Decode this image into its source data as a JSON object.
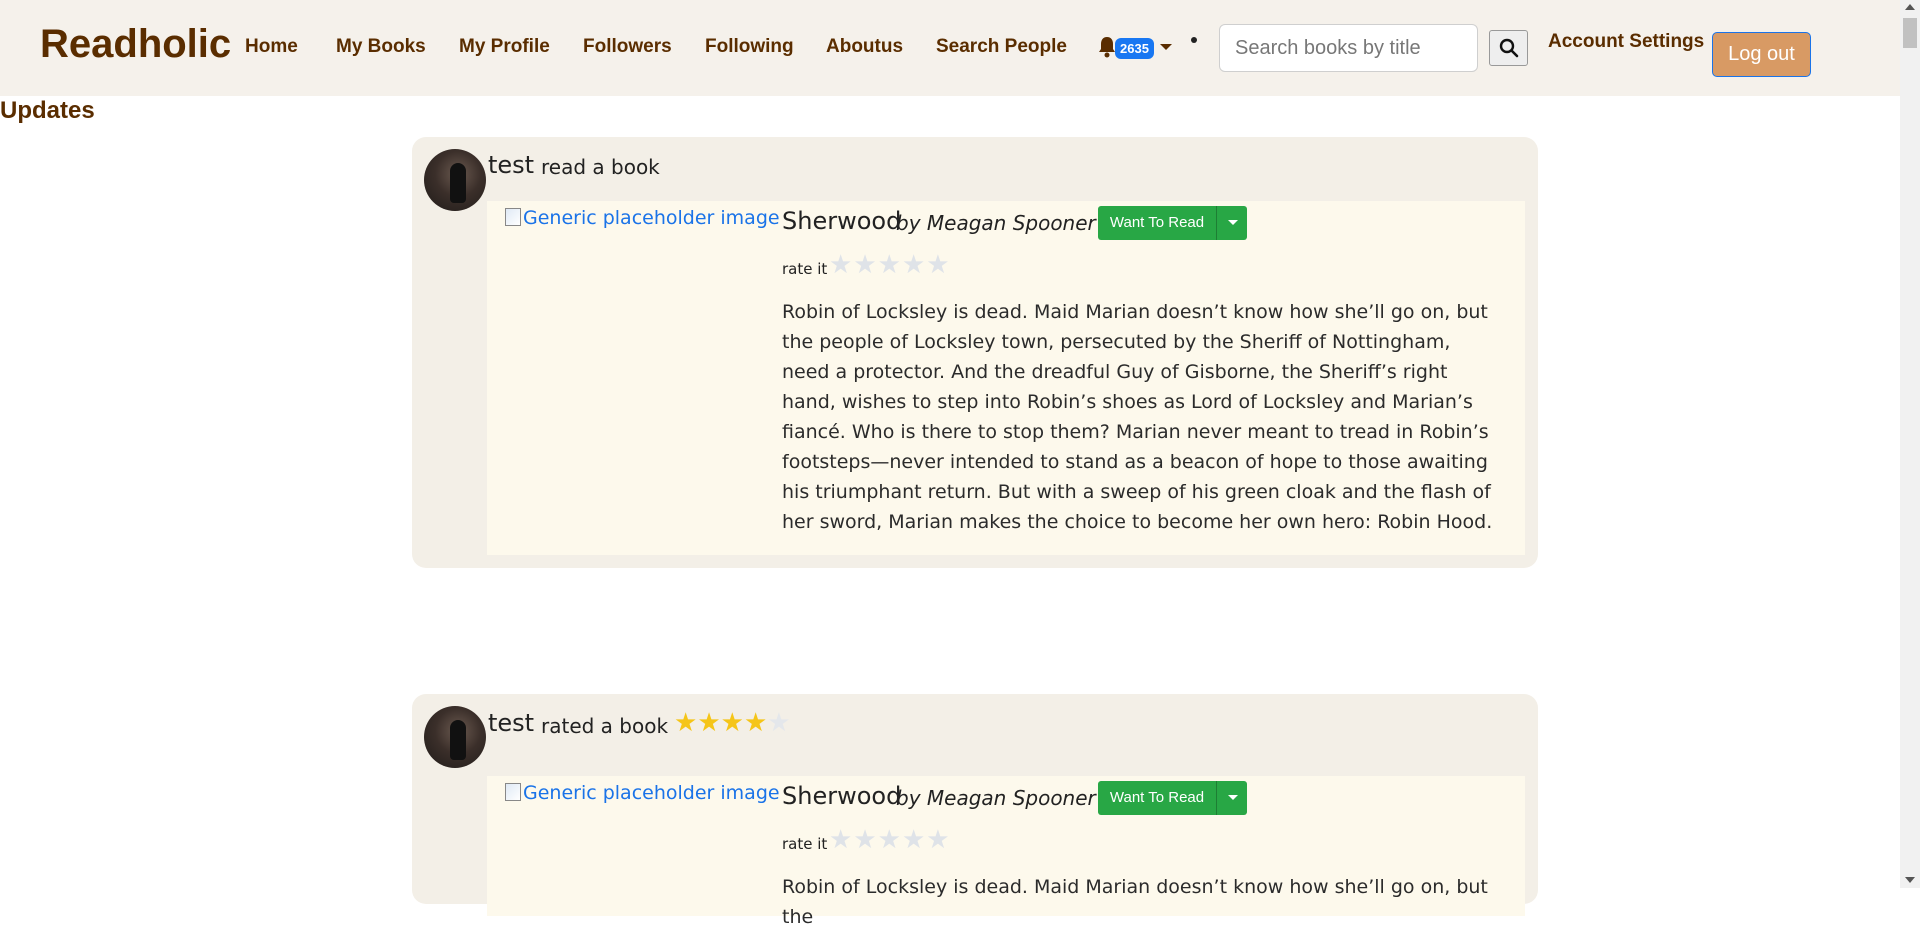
{
  "navbar": {
    "brand": "Readholic",
    "links": [
      "Home",
      "My Books",
      "My Profile",
      "Followers",
      "Following",
      "Aboutus",
      "Search People"
    ],
    "notification_count": "2635",
    "search_placeholder": "Search books by title",
    "account_settings": "Account Settings",
    "logout": "Log out"
  },
  "page": {
    "heading": "Updates"
  },
  "feed": [
    {
      "user": "test",
      "action": "read a book",
      "book": {
        "cover_alt": "Generic placeholder image",
        "title": "Sherwood",
        "author": "by Meagan Spooner",
        "shelf_button": "Want To Read",
        "rate_label": "rate it",
        "description": "Robin of Locksley is dead. Maid Marian doesn’t know how she’ll go on, but the people of Locksley town, persecuted by the Sheriff of Nottingham, need a protector. And the dreadful Guy of Gisborne, the Sheriff’s right hand, wishes to step into Robin’s shoes as Lord of Locksley and Marian’s fiancé. Who is there to stop them? Marian never meant to tread in Robin’s footsteps—never intended to stand as a beacon of hope to those awaiting his triumphant return. But with a sweep of his green cloak and the flash of her sword, Marian makes the choice to become her own hero: Robin Hood."
      }
    },
    {
      "user": "test",
      "action": "rated a book",
      "rating": 4,
      "rating_max": 5,
      "book": {
        "cover_alt": "Generic placeholder image",
        "title": "Sherwood",
        "author": "by Meagan Spooner",
        "shelf_button": "Want To Read",
        "rate_label": "rate it",
        "description": "Robin of Locksley is dead. Maid Marian doesn’t know how she’ll go on, but the"
      }
    }
  ],
  "colors": {
    "navbar_bg": "#f5f1eb",
    "brand_text": "#5a2d00",
    "badge": "#1877f2",
    "logout_bg": "#d89a64",
    "want_button": "#28a745",
    "card_bg": "#f3efe7",
    "book_bg": "#fdf9ec",
    "star_on": "#f5c518"
  },
  "icons": [
    "bell-icon",
    "search-icon",
    "caret-down-icon",
    "star-icon"
  ]
}
